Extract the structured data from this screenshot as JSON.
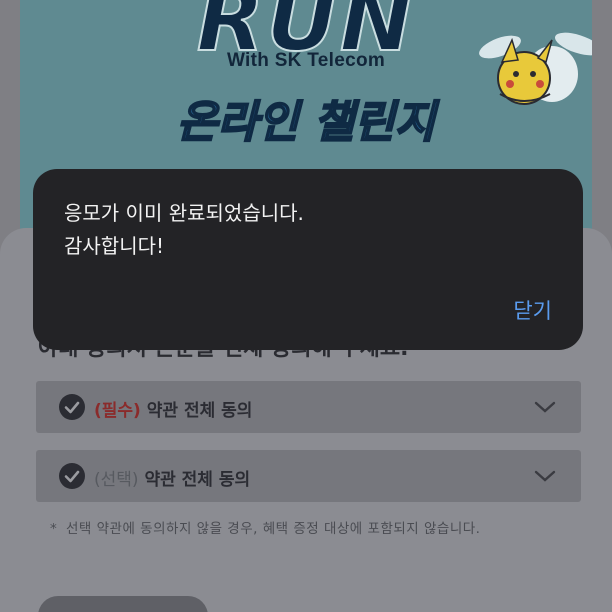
{
  "banner": {
    "title": "RUN",
    "subtitle": "With SK Telecom",
    "challenge": "온라인 챌린지"
  },
  "sheet": {
    "heading": "아래 동의서 본문을 전체 동의해 주세요."
  },
  "agreements": [
    {
      "tag": "(필수)",
      "label": "약관 전체 동의"
    },
    {
      "tag": "(선택)",
      "label": "약관 전체 동의"
    }
  ],
  "note": {
    "bullet": "*",
    "text": "선택 약관에 동의하지 않을 경우, 혜택 증정 대상에 포함되지 않습니다."
  },
  "dialog": {
    "line1": "응모가 이미 완료되었습니다.",
    "line2": "감사합니다!",
    "close_label": "닫기"
  },
  "colors": {
    "dialog_bg": "#232326",
    "close_link": "#5a9cf0",
    "required": "#8a2b2b",
    "banner_bg": "#5f8a91"
  }
}
